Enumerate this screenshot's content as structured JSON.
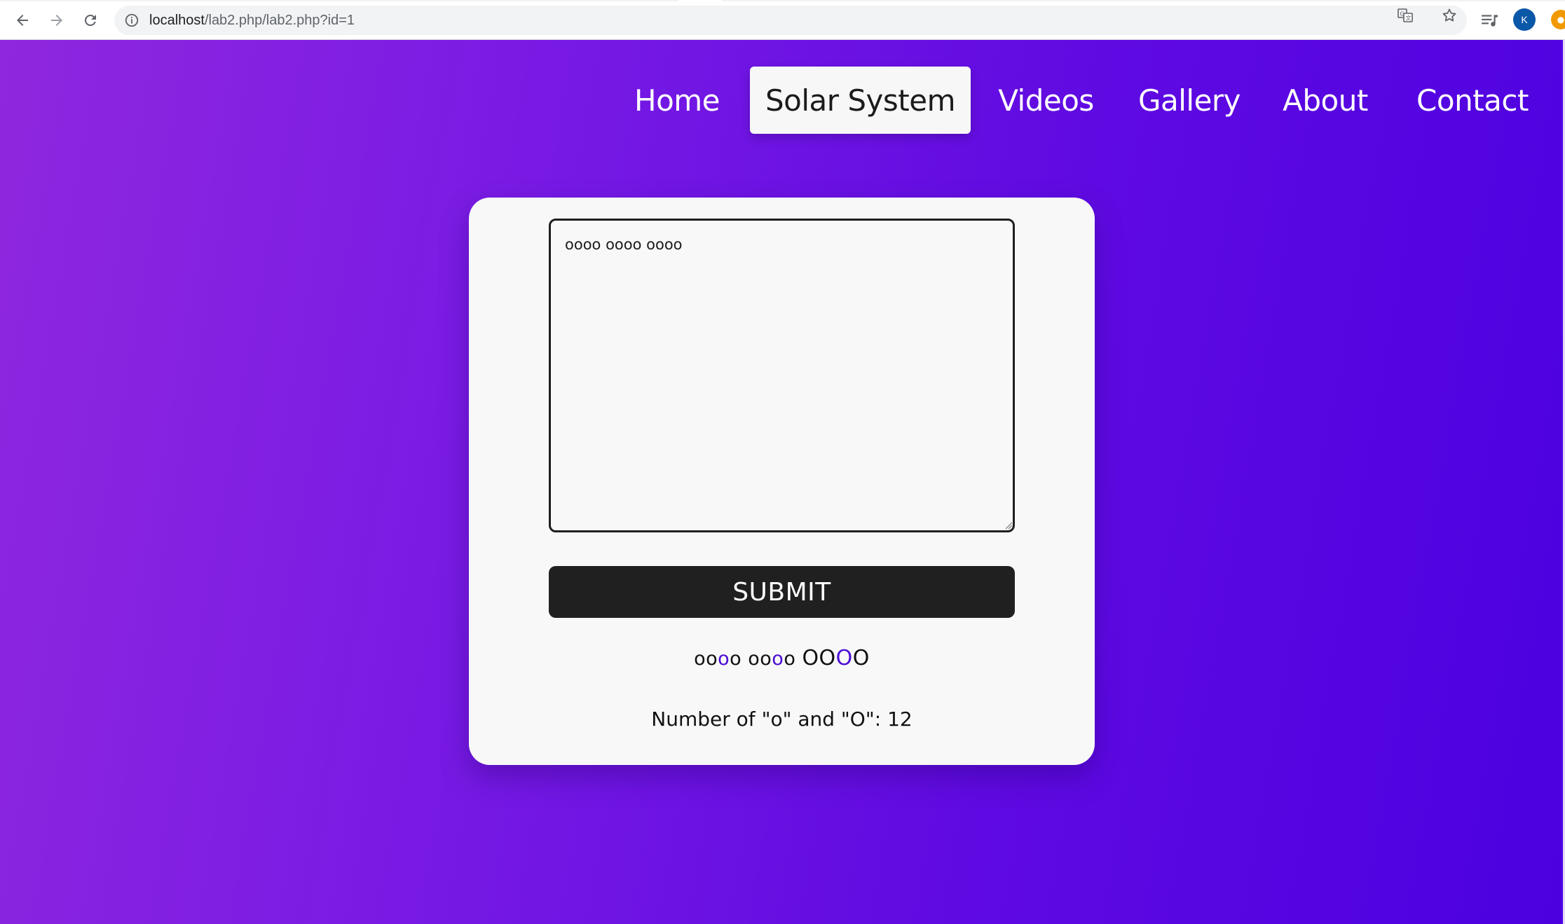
{
  "browser": {
    "url_host": "localhost",
    "url_path": "/lab2.php/lab2.php?id=1",
    "profile_initial": "K",
    "icons": {
      "back": "arrow-left-icon",
      "forward": "arrow-right-icon",
      "reload": "reload-icon",
      "info": "info-icon",
      "translate": "translate-icon",
      "star": "star-icon",
      "playlist": "playlist-icon"
    }
  },
  "nav": {
    "items": [
      {
        "label": "Home",
        "active": false
      },
      {
        "label": "Solar System",
        "active": true
      },
      {
        "label": "Videos",
        "active": false
      },
      {
        "label": "Gallery",
        "active": false
      },
      {
        "label": "About",
        "active": false
      },
      {
        "label": "Contact",
        "active": false
      }
    ]
  },
  "form": {
    "textarea_value": "oooo oooo oooo",
    "submit_label": "SUBMIT"
  },
  "result": {
    "segments": [
      {
        "text": "oo",
        "highlight": false,
        "big": false
      },
      {
        "text": "o",
        "highlight": true,
        "big": false
      },
      {
        "text": "o ",
        "highlight": false,
        "big": false
      },
      {
        "text": "oo",
        "highlight": false,
        "big": false
      },
      {
        "text": "o",
        "highlight": true,
        "big": false
      },
      {
        "text": "o ",
        "highlight": false,
        "big": false
      },
      {
        "text": "OO",
        "highlight": false,
        "big": true
      },
      {
        "text": "O",
        "highlight": true,
        "big": true
      },
      {
        "text": "O",
        "highlight": false,
        "big": true
      }
    ],
    "count_text": "Number of \"o\" and \"O\": 12"
  },
  "colors": {
    "gradient_start": "#8f27de",
    "gradient_end": "#4c00e0",
    "card_bg": "#f8f8f8",
    "button_bg": "#1f201f",
    "highlight": "#4b0bd6",
    "avatar_bg": "#0b57a8"
  }
}
